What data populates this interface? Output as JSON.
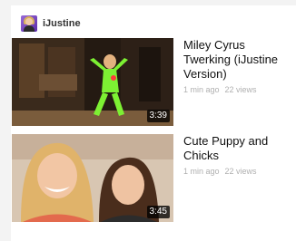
{
  "channel": {
    "name": "iJustine"
  },
  "videos": [
    {
      "title": "Miley Cyrus Twerking (iJustine Version)",
      "duration": "3:39",
      "age": "1 min ago",
      "views": "22 views"
    },
    {
      "title": "Cute Puppy and Chicks",
      "duration": "3:45",
      "age": "1 min ago",
      "views": "22 views"
    }
  ],
  "colors": {
    "background": "#f3f3f3",
    "card": "#ffffff",
    "meta_text": "#b0b0b0"
  }
}
